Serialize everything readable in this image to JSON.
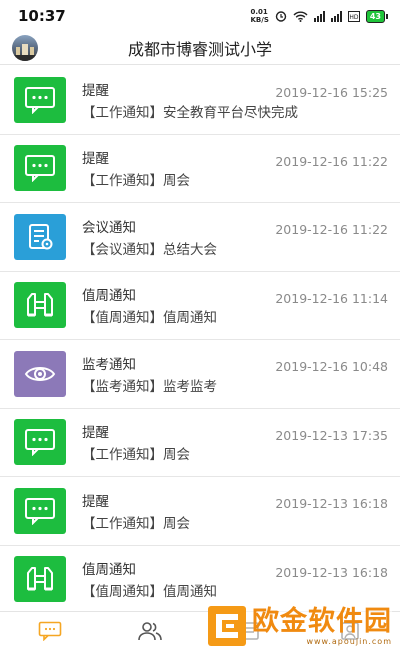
{
  "status_bar": {
    "time": "10:37",
    "net_speed_value": "0.01",
    "net_speed_unit": "KB/S",
    "battery": "43"
  },
  "header": {
    "title": "成都市博睿测试小学"
  },
  "colors": {
    "green": "#1dbd3f",
    "blue": "#2a9fd8",
    "purple": "#8c79b8",
    "accent_orange": "#f5a623"
  },
  "notifications": [
    {
      "icon": "chat-bubble-icon",
      "color": "green",
      "title": "提醒",
      "subtitle": "【工作通知】安全教育平台尽快完成",
      "time": "2019-12-16 15:25"
    },
    {
      "icon": "chat-bubble-icon",
      "color": "green",
      "title": "提醒",
      "subtitle": "【工作通知】周会",
      "time": "2019-12-16 11:22"
    },
    {
      "icon": "meeting-doc-icon",
      "color": "blue",
      "title": "会议通知",
      "subtitle": "【会议通知】总结大会",
      "time": "2019-12-16 11:22"
    },
    {
      "icon": "binoculars-icon",
      "color": "green",
      "title": "值周通知",
      "subtitle": "【值周通知】值周通知",
      "time": "2019-12-16 11:14"
    },
    {
      "icon": "eye-icon",
      "color": "purple",
      "title": "监考通知",
      "subtitle": "【监考通知】监考监考",
      "time": "2019-12-16 10:48"
    },
    {
      "icon": "chat-bubble-icon",
      "color": "green",
      "title": "提醒",
      "subtitle": "【工作通知】周会",
      "time": "2019-12-13 17:35"
    },
    {
      "icon": "chat-bubble-icon",
      "color": "green",
      "title": "提醒",
      "subtitle": "【工作通知】周会",
      "time": "2019-12-13 16:18"
    },
    {
      "icon": "binoculars-icon",
      "color": "green",
      "title": "值周通知",
      "subtitle": "【值周通知】值周通知",
      "time": "2019-12-13 16:18"
    }
  ],
  "tabbar": {
    "tabs": [
      "messages-tab-icon",
      "contacts-tab-icon",
      "apps-tab-icon",
      "profile-tab-icon"
    ]
  },
  "watermark": {
    "text": "欧金软件园",
    "url": "www.apoujin.com"
  }
}
